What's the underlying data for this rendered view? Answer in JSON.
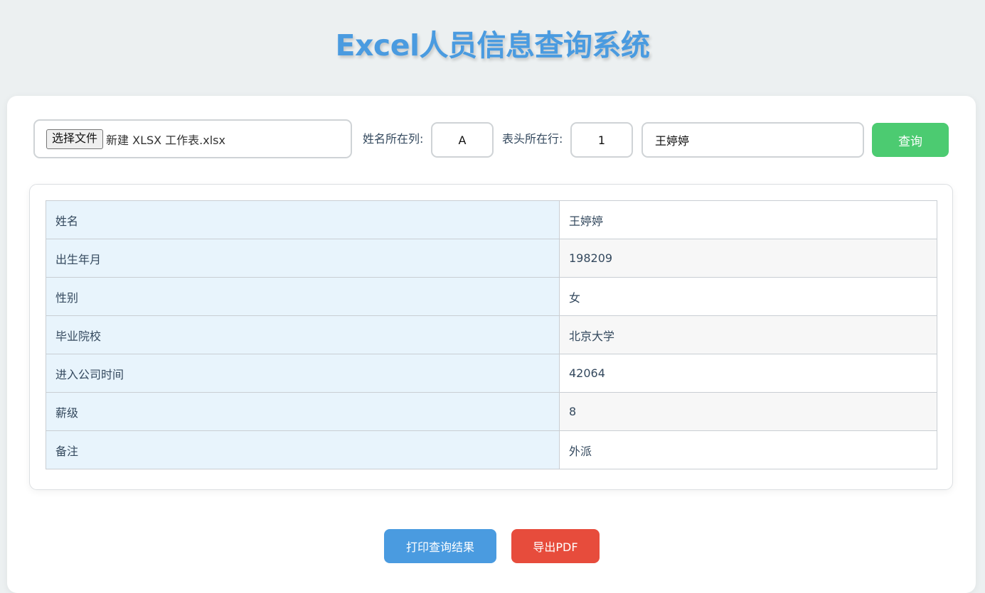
{
  "page": {
    "title": "Excel人员信息查询系统"
  },
  "controls": {
    "file_button_label": "选择文件",
    "file_name": "新建 XLSX 工作表.xlsx",
    "name_column_label": "姓名所在列:",
    "name_column_value": "A",
    "header_row_label": "表头所在行:",
    "header_row_value": "1",
    "search_value": "王婷婷",
    "query_button_label": "查询"
  },
  "result": {
    "rows": [
      {
        "field": "姓名",
        "value": "王婷婷"
      },
      {
        "field": "出生年月",
        "value": "198209"
      },
      {
        "field": "性别",
        "value": "女"
      },
      {
        "field": "毕业院校",
        "value": "北京大学"
      },
      {
        "field": "进入公司时间",
        "value": "42064"
      },
      {
        "field": "薪级",
        "value": "8"
      },
      {
        "field": "备注",
        "value": "外派"
      }
    ]
  },
  "actions": {
    "print_label": "打印查询结果",
    "export_pdf_label": "导出PDF"
  },
  "colors": {
    "title": "#4a9be0",
    "query_button": "#4ccb71",
    "print_button": "#4a9be0",
    "export_button": "#e74c3c",
    "key_cell": "#e8f4fc"
  }
}
